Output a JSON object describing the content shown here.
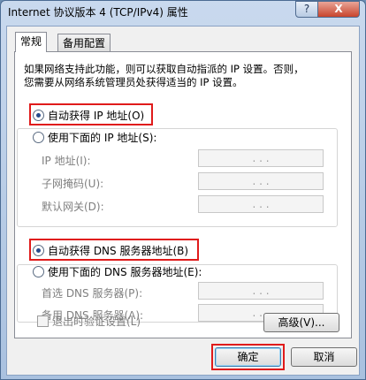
{
  "window": {
    "title": "Internet 协议版本 4 (TCP/IPv4) 属性",
    "help_label": "?",
    "close_label": "X"
  },
  "tabs": [
    {
      "label": "常规"
    },
    {
      "label": "备用配置"
    }
  ],
  "description": {
    "line1": "如果网络支持此功能，则可以获取自动指派的 IP 设置。否则，",
    "line2": "您需要从网络系统管理员处获得适当的 IP 设置。"
  },
  "ip": {
    "auto_label": "自动获得 IP 地址(O)",
    "manual_label": "使用下面的 IP 地址(S):",
    "fields": [
      {
        "label": "IP 地址(I):",
        "value": ". . ."
      },
      {
        "label": "子网掩码(U):",
        "value": ". . ."
      },
      {
        "label": "默认网关(D):",
        "value": ". . ."
      }
    ]
  },
  "dns": {
    "auto_label": "自动获得 DNS 服务器地址(B)",
    "manual_label": "使用下面的 DNS 服务器地址(E):",
    "fields": [
      {
        "label": "首选 DNS 服务器(P):",
        "value": ". . ."
      },
      {
        "label": "备用 DNS 服务器(A):",
        "value": ". . ."
      }
    ]
  },
  "validate_label": "退出时验证设置(L)",
  "advanced_label": "高级(V)...",
  "ok_label": "确定",
  "cancel_label": "取消",
  "colors": {
    "highlight": "#e01b1b"
  }
}
